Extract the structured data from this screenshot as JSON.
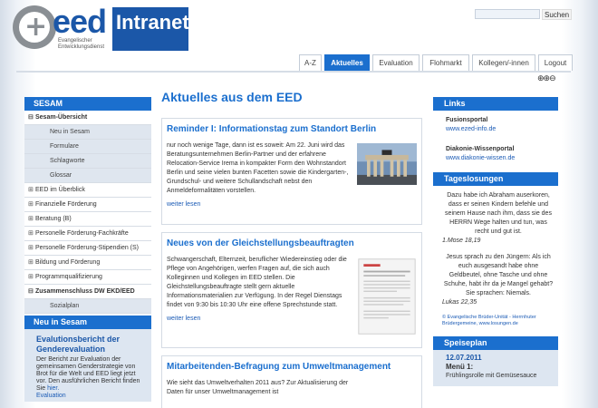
{
  "header": {
    "logo_text": "eed",
    "logo_sub_line1": "Evangelischer",
    "logo_sub_line2": "Entwicklungsdienst",
    "intranet_label": "Intranet",
    "search_button": "Suchen",
    "search_value": ""
  },
  "tabs": [
    {
      "label": "A-Z",
      "active": false
    },
    {
      "label": "Aktuelles",
      "active": true
    },
    {
      "label": "Evaluation",
      "active": false
    },
    {
      "label": "Flohmarkt",
      "active": false
    },
    {
      "label": "Kollegen/-innen",
      "active": false
    },
    {
      "label": "Logout",
      "active": false
    }
  ],
  "zoom_icons": "⊕⊕⊖",
  "left": {
    "sesam_title": "SESAM",
    "items": [
      {
        "label": "Sesam-Übersicht",
        "sign": "⊟",
        "bold": true
      },
      {
        "label": "Neu in Sesam",
        "sub": true
      },
      {
        "label": "Formulare",
        "sub": true
      },
      {
        "label": "Schlagworte",
        "sub": true
      },
      {
        "label": "Glossar",
        "sub": true
      },
      {
        "label": "EED im Überblick",
        "sign": "⊞"
      },
      {
        "label": "Finanzielle Förderung",
        "sign": "⊞"
      },
      {
        "label": "Beratung (B)",
        "sign": "⊞"
      },
      {
        "label": "Personelle Förderung-Fachkräfte",
        "sign": "⊞"
      },
      {
        "label": "Personelle Förderung-Stipendien (S)",
        "sign": "⊞"
      },
      {
        "label": "Bildung und Förderung",
        "sign": "⊞"
      },
      {
        "label": "Programmqualifizierung",
        "sign": "⊞"
      },
      {
        "label": "Zusammenschluss DW EKD/EED",
        "sign": "⊟",
        "bold": true
      },
      {
        "label": "Sozialplan",
        "sub": true
      }
    ],
    "neu_title": "Neu in Sesam",
    "neu_item_title": "Evalutionsbericht der Genderevaluation",
    "neu_item_text": "Der Bericht zur Evaluation der gemeinsamen Genderstrategie von Brot für die Welt und EED liegt jetzt vor. Den ausführlichen Bericht finden Sie ",
    "neu_item_link": "hier.",
    "neu_item_next": "Evaluation"
  },
  "main": {
    "title": "Aktuelles aus dem EED",
    "articles": [
      {
        "title": "Reminder I: Informationstag zum Standort Berlin",
        "text": "nur noch wenige Tage, dann ist es soweit: Am 22. Juni wird das Beratungsunternehmen Berlin-Partner und der erfahrene Relocation-Service Irema in kompakter Form den Wohnstandort Berlin und seine vielen bunten Facetten sowie die Kindergarten-, Grundschul- und weitere Schullandschaft nebst den Anmeldeformalitäten vorstellen.",
        "more": "weiter lesen"
      },
      {
        "title": "Neues von der Gleichstellungsbeauftragten",
        "text": "Schwangerschaft, Elternzeit, beruflicher Wiedereinstieg oder die Pflege von Angehörigen, werfen Fragen auf, die sich auch Kolleginnen und Kollegen im EED stellen. Die Gleichstellungsbeauftragte stellt gern aktuelle Informationsmaterialien zur Verfügung. In der Regel Dienstags findet von 9:30 bis 10:30 Uhr eine offene Sprechstunde statt.",
        "more": "weiter lesen"
      },
      {
        "title": "Mitarbeitenden-Befragung zum Umweltmanagement",
        "text": "Wie sieht das Umweltverhalten 2011 aus? Zur Aktualisierung der Daten für unser Umweltmanagement ist",
        "more": ""
      }
    ]
  },
  "right": {
    "links_title": "Links",
    "links": [
      {
        "title": "Fusionsportal",
        "url": "www.ezed-info.de"
      },
      {
        "title": "Diakonie-Wissenportal",
        "url": "www.diakonie-wissen.de"
      }
    ],
    "tages_title": "Tageslosungen",
    "quote1": "Dazu habe ich Abraham auserkoren, dass er seinen Kindern befehle und seinem Hause nach ihm, dass sie des HERRN Wege halten und tun, was recht und gut ist.",
    "quote1_ref": "1.Mose 18,19",
    "quote2": "Jesus sprach zu den Jüngern: Als ich euch ausgesandt habe ohne Geldbeutel, ohne Tasche und ohne Schuhe, habt ihr da je Mangel gehabt? Sie sprachen: Niemals.",
    "quote2_ref": "Lukas 22,35",
    "copyright": "© Evangelische Brüder-Unität - Herrnhuter Brüdergemeine, www.losungen.de",
    "speise_title": "Speiseplan",
    "speise_date": "12.07.2011",
    "speise_menu": "Menü 1:",
    "speise_desc": "Frühlingsrolle mit Gemüsesauce"
  }
}
